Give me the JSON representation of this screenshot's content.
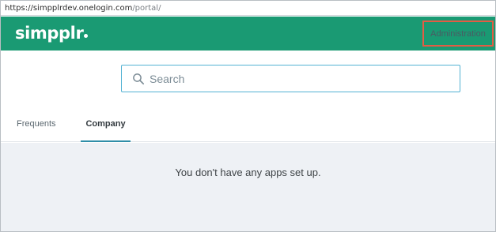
{
  "browser": {
    "url_host": "https://simpplrdev.onelogin.com",
    "url_path": "/portal/"
  },
  "header": {
    "logo_text": "simpplr",
    "admin_label": "Administration",
    "bg_color": "#1a9a73",
    "highlight_color": "#e35c44"
  },
  "search": {
    "placeholder": "Search",
    "value": "",
    "icon": "search-icon"
  },
  "tabs": [
    {
      "label": "Frequents",
      "active": false
    },
    {
      "label": "Company",
      "active": true
    }
  ],
  "content": {
    "empty_message": "You don't have any apps set up."
  }
}
